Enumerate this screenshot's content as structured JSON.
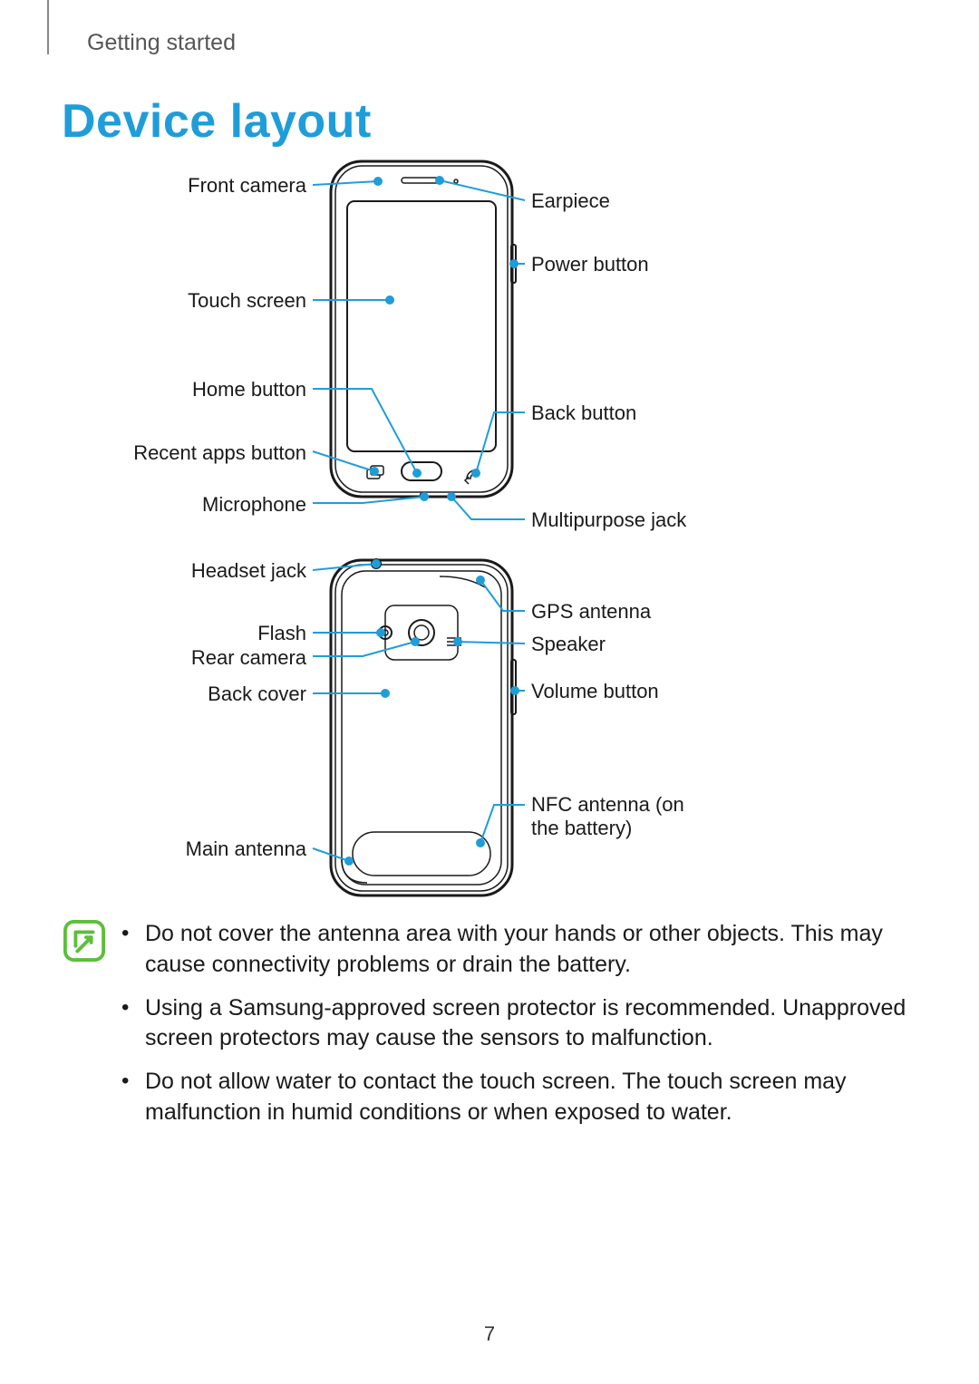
{
  "section": "Getting started",
  "title": "Device layout",
  "page_number": "7",
  "accent_color": "#1F9DD9",
  "labels": {
    "left": {
      "front_camera": "Front camera",
      "touch_screen": "Touch screen",
      "home_button": "Home button",
      "recent_apps_button": "Recent apps button",
      "microphone": "Microphone",
      "headset_jack": "Headset jack",
      "flash": "Flash",
      "rear_camera": "Rear camera",
      "back_cover": "Back cover",
      "main_antenna": "Main antenna"
    },
    "right": {
      "earpiece": "Earpiece",
      "power_button": "Power button",
      "back_button": "Back button",
      "multipurpose_jack": "Multipurpose jack",
      "gps_antenna": "GPS antenna",
      "speaker": "Speaker",
      "volume_button": "Volume button",
      "nfc_antenna": "NFC antenna (on the battery)"
    }
  },
  "notes": [
    "Do not cover the antenna area with your hands or other objects. This may cause connectivity problems or drain the battery.",
    "Using a Samsung-approved screen protector is recommended. Unapproved screen protectors may cause the sensors to malfunction.",
    "Do not allow water to contact the touch screen. The touch screen may malfunction in humid conditions or when exposed to water."
  ]
}
